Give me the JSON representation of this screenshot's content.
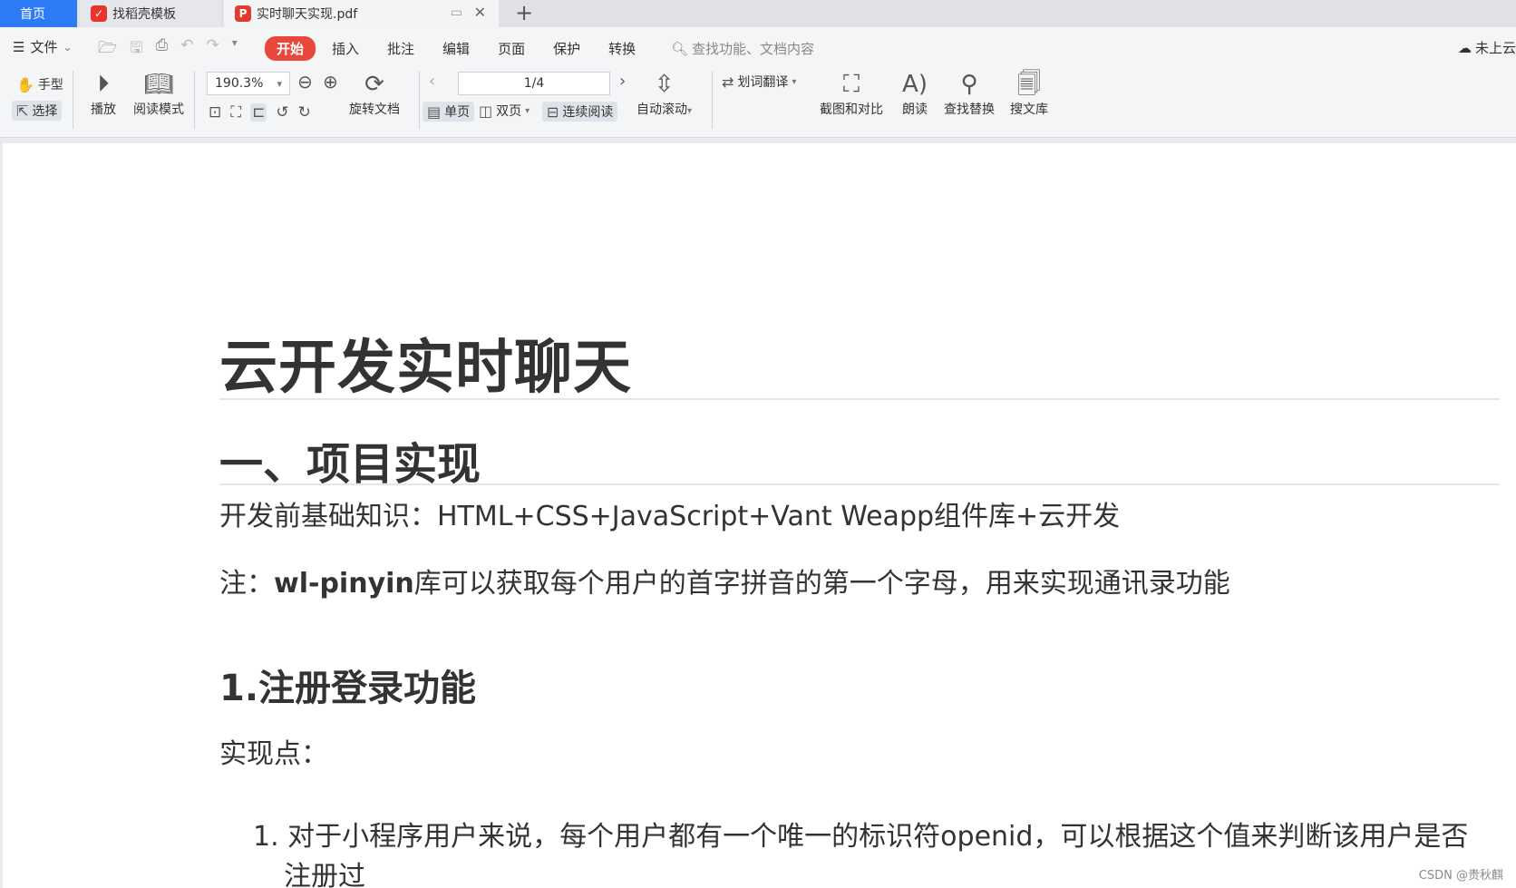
{
  "tabs": {
    "home": "首页",
    "template": "找稻壳模板",
    "pdf": "实时聊天实现.pdf",
    "add": "+"
  },
  "menu": {
    "file": "文件",
    "tabs": [
      "开始",
      "插入",
      "批注",
      "编辑",
      "页面",
      "保护",
      "转换"
    ],
    "active_tab": "开始",
    "search_placeholder": "查找功能、文档内容",
    "cloud": "未上云"
  },
  "ribbon": {
    "hand": "手型",
    "select": "选择",
    "play": "播放",
    "read_mode": "阅读模式",
    "zoom": "190.3%",
    "rotate": "旋转文档",
    "page_indicator": "1/4",
    "single_page": "单页",
    "double_page": "双页",
    "continuous": "连续阅读",
    "auto_scroll": "自动滚动",
    "translate": "划词翻译",
    "screenshot_compare": "截图和对比",
    "read_aloud": "朗读",
    "find_replace": "查找替换",
    "search_library": "搜文库"
  },
  "document": {
    "title": "云开发实时聊天",
    "heading1": "一、项目实现",
    "para1": "开发前基础知识：HTML+CSS+JavaScript+Vant Weapp组件库+云开发",
    "note_prefix": "注：",
    "note_bold": "wl-pinyin",
    "note_rest": "库可以获取每个用户的首字拼音的第一个字母，用来实现通讯录功能",
    "heading2": "1.注册登录功能",
    "points_label": "实现点：",
    "list_item1_num": "1.",
    "list_item1": "对于小程序用户来说，每个用户都有一个唯一的标识符openid，可以根据这个值来判断该用户是否",
    "list_item1_cont": "注册过"
  },
  "watermark": "CSDN @贵秋麒"
}
